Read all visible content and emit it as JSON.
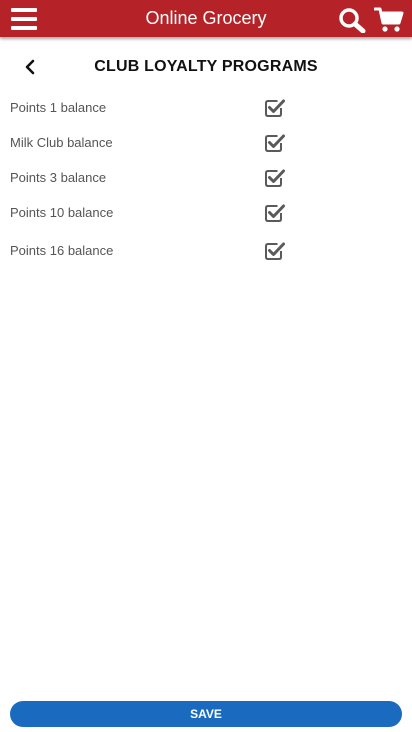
{
  "header": {
    "title": "Online Grocery",
    "menu_icon": "hamburger-menu-icon",
    "search_icon": "search-icon",
    "cart_icon": "shopping-cart-icon",
    "brand_color": "#b52227"
  },
  "page": {
    "back_icon": "chevron-left-icon",
    "title": "CLUB LOYALTY PROGRAMS"
  },
  "programs": [
    {
      "label": "Points 1 balance",
      "checked": true
    },
    {
      "label": "Milk Club balance",
      "checked": true
    },
    {
      "label": "Points 3 balance",
      "checked": true
    },
    {
      "label": "Points 10 balance",
      "checked": true
    },
    {
      "label": "Points 16 balance",
      "checked": true
    }
  ],
  "footer": {
    "save_label": "SAVE",
    "save_color": "#1a6bbf"
  }
}
